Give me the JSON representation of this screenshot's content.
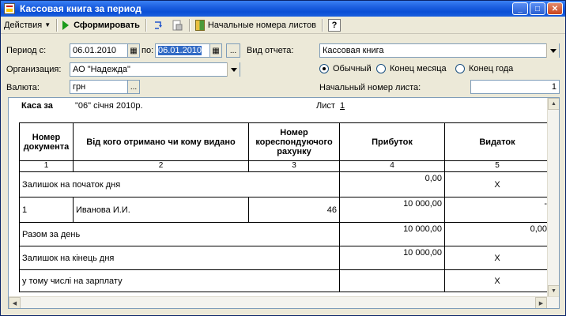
{
  "window": {
    "title": "Кассовая книга за период"
  },
  "toolbar": {
    "actions_label": "Действия",
    "generate_label": "Сформировать",
    "page_numbers_label": "Начальные номера листов",
    "help_label": "?"
  },
  "form": {
    "period_from_label": "Период с:",
    "period_from_value": "06.01.2010",
    "period_to_label": "по:",
    "period_to_value": "06.01.2010",
    "report_type_label": "Вид отчета:",
    "report_type_value": "Кассовая книга",
    "org_label": "Организация:",
    "org_value": "АО \"Надежда\"",
    "currency_label": "Валюта:",
    "currency_value": "грн",
    "mode_normal": "Обычный",
    "mode_month_end": "Конец месяца",
    "mode_year_end": "Конец года",
    "selected_mode": "Обычный",
    "start_page_label": "Начальный номер листа:",
    "start_page_value": "1",
    "ellipsis": "..."
  },
  "report": {
    "kasa_label": "Каса за",
    "date_text": "\"06\" січня 2010р.",
    "sheet_label": "Лист",
    "sheet_value": "1",
    "headers": {
      "doc_no": "Номер документа",
      "from_to": "Від кого отримано чи кому видано",
      "corr_account": "Номер кореспондуючого рахунку",
      "income": "Прибуток",
      "expense": "Видаток"
    },
    "col_numbers": [
      "1",
      "2",
      "3",
      "4",
      "5"
    ],
    "rows": {
      "opening_balance": {
        "label": "Залишок на початок дня",
        "income": "0,00",
        "expense": "X"
      },
      "entry": {
        "doc": "1",
        "name": "Иванова И.И.",
        "account": "46",
        "income": "10 000,00",
        "expense": "-"
      },
      "day_total": {
        "label": "Разом за день",
        "income": "10 000,00",
        "expense": "0,00"
      },
      "closing_balance": {
        "label": "Залишок на кінець дня",
        "income": "10 000,00",
        "expense": "X"
      },
      "salary": {
        "label": "у тому числі на зарплату",
        "income": "",
        "expense": "X"
      }
    }
  }
}
